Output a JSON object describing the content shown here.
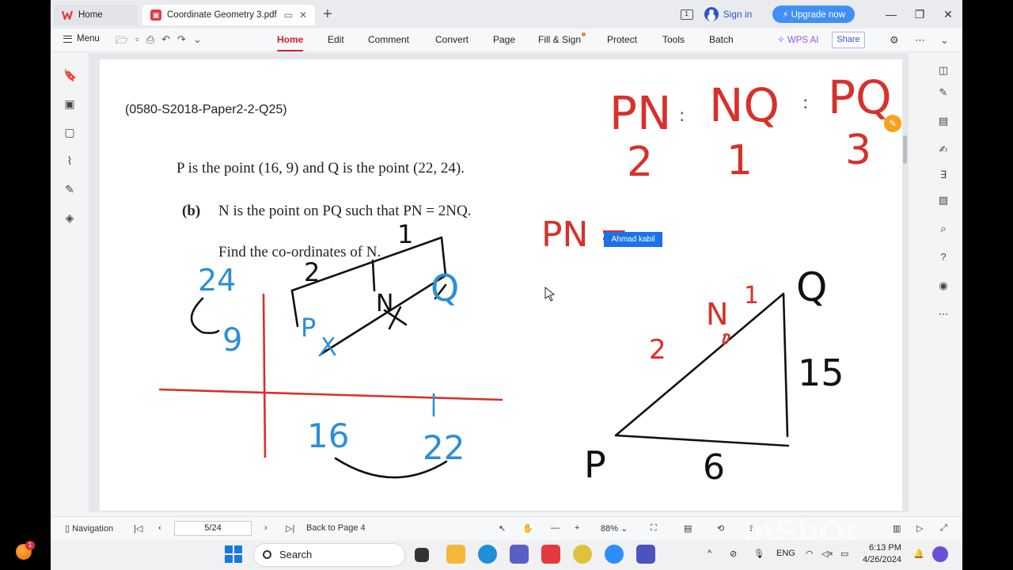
{
  "titlebar": {
    "home_tab": "Home",
    "doc_tab": "Coordinate Geometry 3.pdf",
    "sign_in": "Sign in",
    "upgrade": "Upgrade now",
    "badge": "1"
  },
  "ribbon": {
    "menu": "Menu",
    "tabs": [
      "Home",
      "Edit",
      "Comment",
      "Convert",
      "Page",
      "Fill & Sign",
      "Protect",
      "Tools",
      "Batch"
    ],
    "active_tab": "Home",
    "wps_ai": "WPS AI",
    "share": "Share"
  },
  "document": {
    "question_ref": "(0580-S2018-Paper2-2-Q25)",
    "line1": "P is the point (16, 9) and Q is the point (22, 24).",
    "part_label": "(b)",
    "line2": "N is the point on PQ such that PN = 2NQ.",
    "line3": "Find the co-ordinates of N.",
    "annotation_tag": "Ahmad kabil"
  },
  "handwriting": {
    "ratio_top": [
      "PN",
      ":",
      "NQ",
      ":",
      "PQ"
    ],
    "ratio_bottom": [
      "2",
      "1",
      "3"
    ],
    "pn_eq": "PN =",
    "graph_y": [
      "24",
      "9"
    ],
    "graph_x": [
      "16",
      "22"
    ],
    "box_labels": [
      "2",
      "1",
      "P",
      "N",
      "Q"
    ],
    "triangle": {
      "p": "P",
      "q": "Q",
      "n": "N",
      "seg_2": "2",
      "seg_1": "1",
      "height": "15",
      "base": "6"
    }
  },
  "statusbar": {
    "navigation": "Navigation",
    "page": "5/24",
    "back_to_page": "Back to Page 4",
    "zoom": "88%"
  },
  "taskbar": {
    "search": "Search",
    "lang": "ENG",
    "time": "6:13 PM",
    "date": "4/26/2024",
    "orb_badge": "1"
  },
  "watermark": "InShOt",
  "colors": {
    "accent": "#d81e2a",
    "ink_red": "#d8302a",
    "ink_blue": "#2b8fd6",
    "ink_black": "#111111",
    "link": "#2b57c9"
  }
}
